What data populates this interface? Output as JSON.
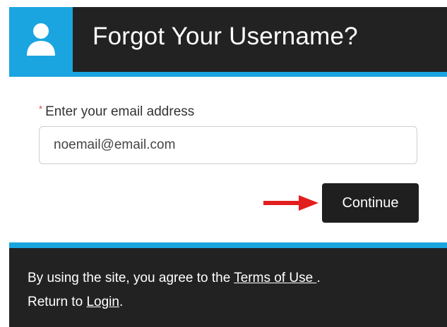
{
  "header": {
    "title": "Forgot Your Username?",
    "icon": "user-icon"
  },
  "form": {
    "required_marker": "*",
    "email_label": "Enter your email address",
    "email_value": "noemail@email.com",
    "continue_label": "Continue"
  },
  "annotation": {
    "icon": "red-arrow-icon"
  },
  "footer": {
    "terms_prefix": "By using the site, you agree to the ",
    "terms_link": "Terms of Use ",
    "terms_suffix": ".",
    "return_prefix": "Return to ",
    "login_link": "Login",
    "return_suffix": "."
  },
  "colors": {
    "accent": "#1aa5e0",
    "dark": "#222222",
    "required": "#d43f3a",
    "arrow": "#e31e1e"
  }
}
